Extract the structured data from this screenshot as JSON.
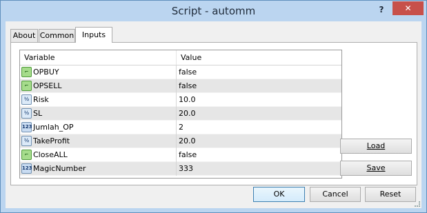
{
  "window": {
    "title": "Script - automm"
  },
  "title_buttons": {
    "help": "?",
    "close": "✕"
  },
  "tabs": [
    {
      "label": "About",
      "active": false
    },
    {
      "label": "Common",
      "active": false
    },
    {
      "label": "Inputs",
      "active": true
    }
  ],
  "grid": {
    "headers": {
      "variable": "Variable",
      "value": "Value"
    },
    "rows": [
      {
        "name": "OPBUY",
        "value": "false",
        "icon": "bool-icon",
        "alt": false
      },
      {
        "name": "OPSELL",
        "value": "false",
        "icon": "bool-icon",
        "alt": true
      },
      {
        "name": "Risk",
        "value": "10.0",
        "icon": "double-icon",
        "alt": false
      },
      {
        "name": "SL",
        "value": "20.0",
        "icon": "double-icon",
        "alt": true
      },
      {
        "name": "Jumlah_OP",
        "value": "2",
        "icon": "integer-icon",
        "alt": false
      },
      {
        "name": "TakeProfit",
        "value": "20.0",
        "icon": "double-icon",
        "alt": true
      },
      {
        "name": "CloseALL",
        "value": "false",
        "icon": "bool-icon",
        "alt": false
      },
      {
        "name": "MagicNumber",
        "value": "333",
        "icon": "integer-icon",
        "alt": true
      }
    ]
  },
  "side_buttons": {
    "load": "Load",
    "save": "Save"
  },
  "footer_buttons": {
    "ok": "OK",
    "cancel": "Cancel",
    "reset": "Reset"
  },
  "colors": {
    "title_bar": "#bbd5f0",
    "close_button": "#c7504a",
    "alt_row": "#e6e6e6"
  }
}
